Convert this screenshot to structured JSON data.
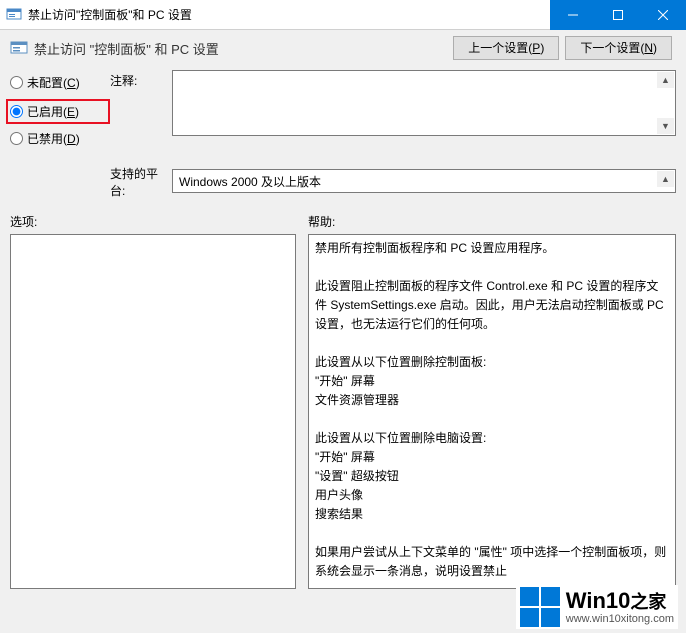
{
  "titlebar": {
    "text": "禁止访问\"控制面板\"和 PC 设置"
  },
  "header": {
    "title": "禁止访问 \"控制面板\" 和 PC 设置",
    "prev_btn": "上一个设置",
    "prev_btn_key": "P",
    "next_btn": "下一个设置",
    "next_btn_key": "N"
  },
  "radios": {
    "not_configured": "未配置",
    "not_configured_key": "C",
    "enabled": "已启用",
    "enabled_key": "E",
    "disabled": "已禁用",
    "disabled_key": "D"
  },
  "labels": {
    "comment": "注释:",
    "platform": "支持的平台:",
    "options": "选项:",
    "help": "帮助:"
  },
  "platform_value": "Windows 2000 及以上版本",
  "help_text": {
    "l1": "禁用所有控制面板程序和 PC 设置应用程序。",
    "l2": "此设置阻止控制面板的程序文件 Control.exe 和 PC 设置的程序文件 SystemSettings.exe 启动。因此，用户无法启动控制面板或 PC 设置，也无法运行它们的任何项。",
    "l3": "此设置从以下位置删除控制面板:",
    "l4": "\"开始\" 屏幕",
    "l5": "文件资源管理器",
    "l6": "此设置从以下位置删除电脑设置:",
    "l7": "\"开始\" 屏幕",
    "l8": "\"设置\" 超级按钮",
    "l9": "用户头像",
    "l10": "搜索结果",
    "l11": "如果用户尝试从上下文菜单的 \"属性\" 项中选择一个控制面板项，则系统会显示一条消息，说明设置禁止"
  },
  "watermark": {
    "big": "Win10",
    "suffix": "之家",
    "url": "www.win10xitong.com"
  }
}
